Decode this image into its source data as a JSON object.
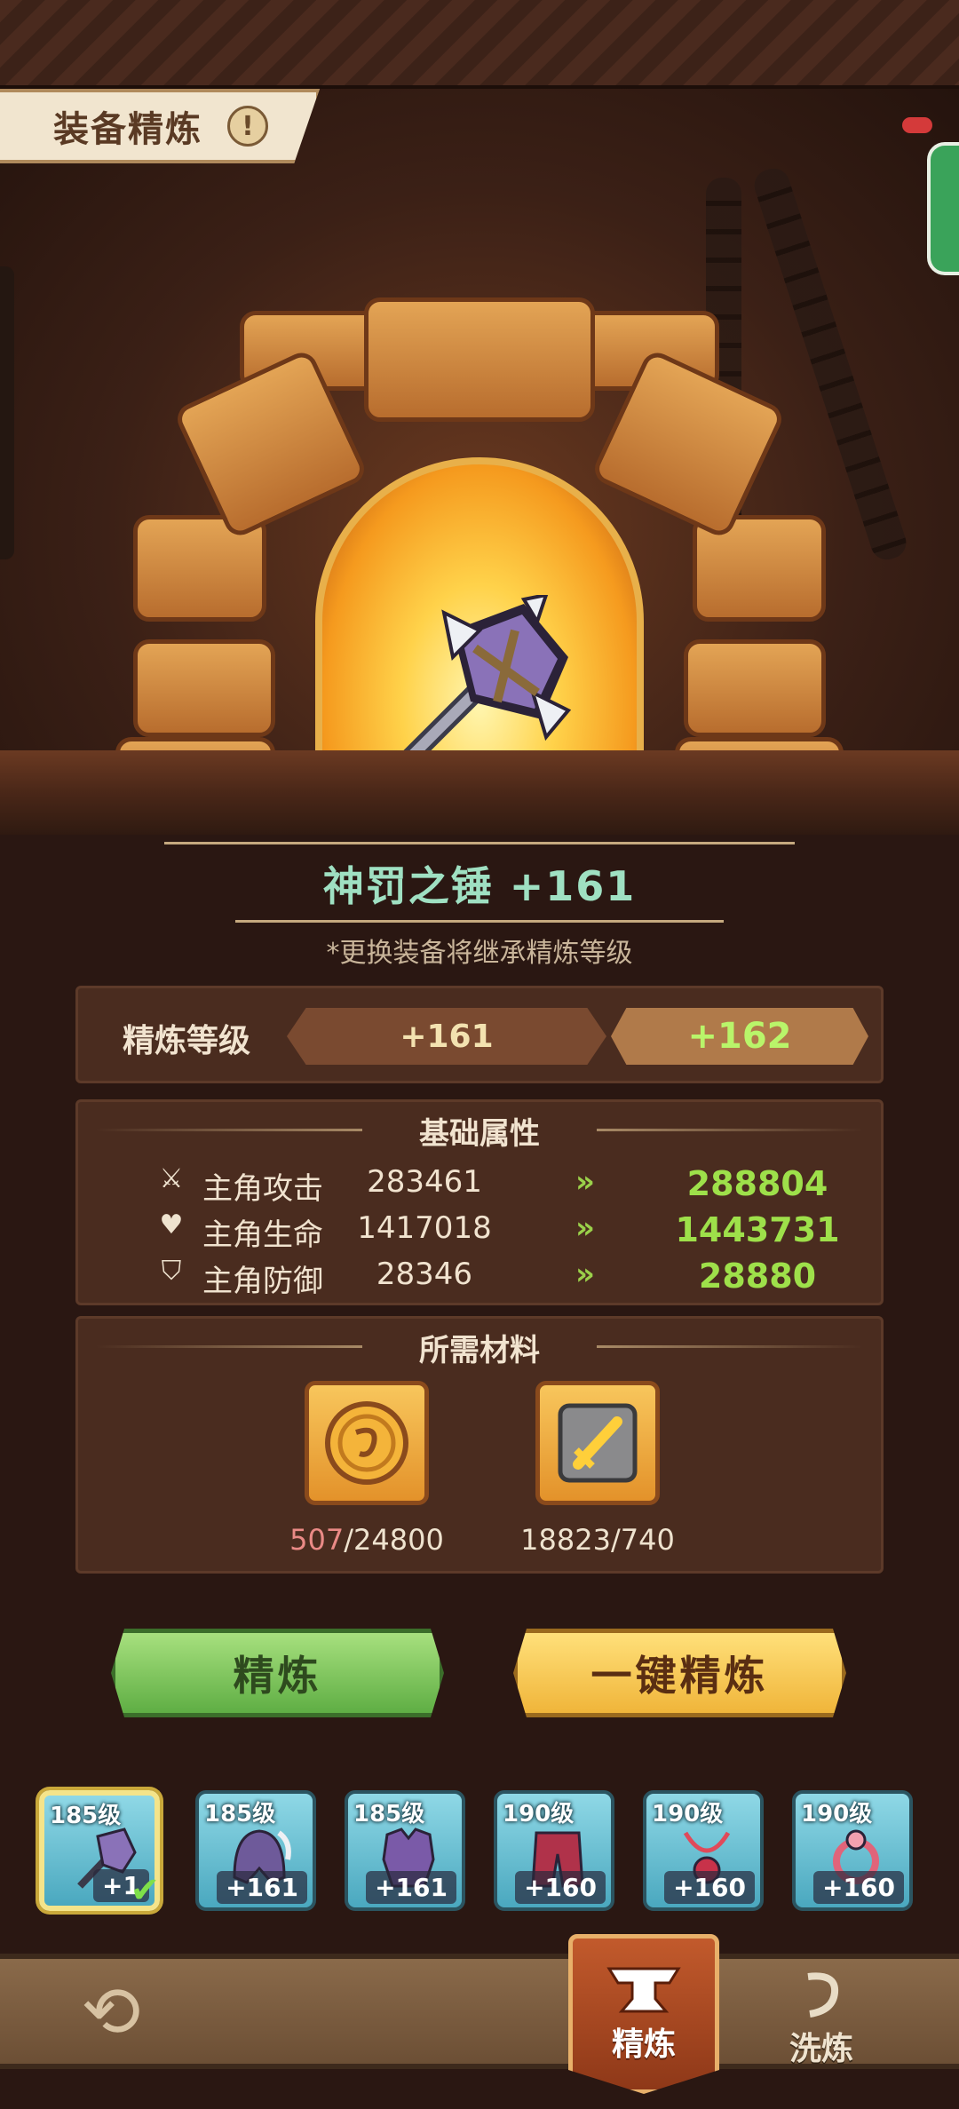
{
  "header": {
    "title": "装备精炼",
    "info_icon": "!"
  },
  "equipment": {
    "name": "神罚之锤 +161",
    "hint": "*更换装备将继承精炼等级"
  },
  "refine_level": {
    "label": "精炼等级",
    "current": "+161",
    "next": "+162"
  },
  "base_stats": {
    "title": "基础属性",
    "rows": [
      {
        "icon": "sword-icon",
        "name": "主角攻击",
        "current": "283461",
        "next": "288804"
      },
      {
        "icon": "heart-icon",
        "name": "主角生命",
        "current": "1417018",
        "next": "1443731"
      },
      {
        "icon": "shield-icon",
        "name": "主角防御",
        "current": "28346",
        "next": "28880"
      }
    ]
  },
  "materials": {
    "title": "所需材料",
    "items": [
      {
        "icon": "gold-coin-icon",
        "have": "507",
        "need": "/24800",
        "insufficient": true
      },
      {
        "icon": "refine-stone-icon",
        "have": "18823",
        "need": "/740",
        "insufficient": false
      }
    ]
  },
  "buttons": {
    "refine": "精炼",
    "one_click_refine": "一键精炼"
  },
  "equipment_slots": [
    {
      "level": "185级",
      "plus": "+1",
      "selected": true,
      "icon": "hammer-icon"
    },
    {
      "level": "185级",
      "plus": "+161",
      "selected": false,
      "icon": "helmet-icon"
    },
    {
      "level": "185级",
      "plus": "+161",
      "selected": false,
      "icon": "armor-icon"
    },
    {
      "level": "190级",
      "plus": "+160",
      "selected": false,
      "icon": "pants-icon"
    },
    {
      "level": "190级",
      "plus": "+160",
      "selected": false,
      "icon": "necklace-icon"
    },
    {
      "level": "190级",
      "plus": "+160",
      "selected": false,
      "icon": "ring-icon"
    }
  ],
  "nav": {
    "refine": "精炼",
    "wash": "洗炼"
  },
  "colors": {
    "accent_green": "#9ee04a",
    "name_teal": "#9fe0c2",
    "insufficient_red": "#ea8a86"
  }
}
